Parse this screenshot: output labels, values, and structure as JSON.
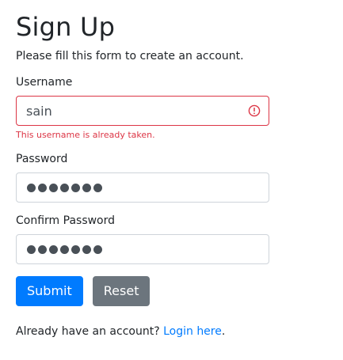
{
  "page": {
    "title": "Sign Up",
    "intro": "Please fill this form to create an account."
  },
  "form": {
    "username": {
      "label": "Username",
      "value": "sain",
      "error": "This username is already taken."
    },
    "password": {
      "label": "Password",
      "masked_length": 7
    },
    "confirm_password": {
      "label": "Confirm Password",
      "masked_length": 7
    },
    "submit_label": "Submit",
    "reset_label": "Reset"
  },
  "footer": {
    "prompt": "Already have an account?",
    "login_link": "Login here",
    "trailing": "."
  },
  "colors": {
    "primary": "#007bff",
    "secondary": "#6c757d",
    "danger": "#dc3545",
    "text": "#212529"
  },
  "icons": {
    "username_invalid": "exclamation-circle-icon"
  }
}
